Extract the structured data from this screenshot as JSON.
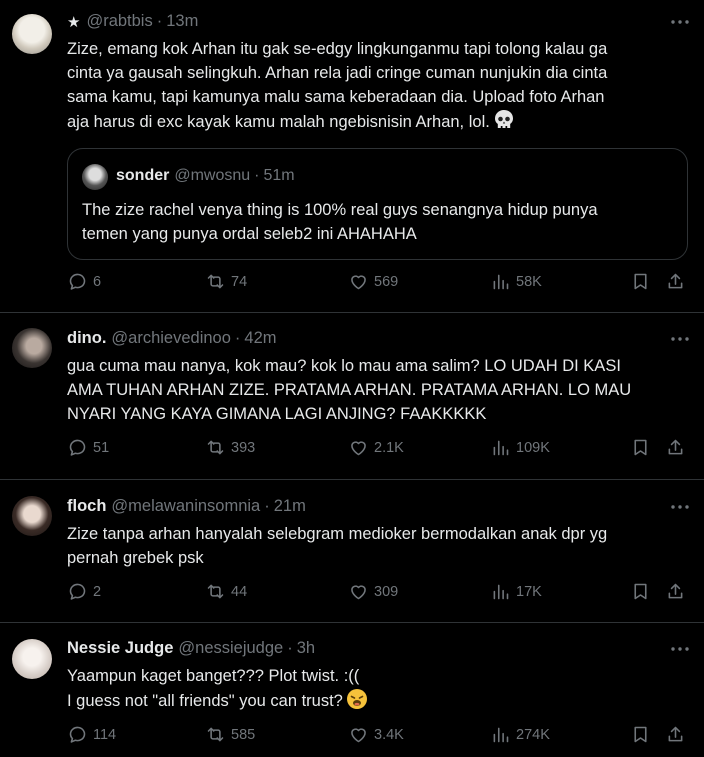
{
  "posts": [
    {
      "name": "",
      "star": "★",
      "handle": "@rabtbis",
      "time": "13m",
      "lines": [
        "Zize, emang kok Arhan itu gak se-edgy lingkunganmu tapi tolong kalau ga",
        "cinta ya gausah selingkuh. Arhan rela jadi cringe cuman nunjukin dia cinta",
        "sama kamu, tapi kamunya malu sama keberadaan dia. Upload foto Arhan",
        "aja harus di exc kayak kamu malah ngebisnisin Arhan, lol."
      ],
      "emoji": "skull",
      "quote": {
        "name": "sonder",
        "handle": "@mwosnu",
        "time": "51m",
        "lines": [
          "The zize rachel venya thing is 100% real guys senangnya hidup punya",
          "temen yang punya ordal seleb2 ini AHAHAHA"
        ]
      },
      "replies": "6",
      "reposts": "74",
      "likes": "569",
      "views": "58K"
    },
    {
      "name": "dino.",
      "handle": "@archievedinoo",
      "time": "42m",
      "lines": [
        "gua cuma mau nanya, kok mau? kok lo mau ama salim? LO UDAH DI KASI",
        "AMA TUHAN ARHAN ZIZE. PRATAMA ARHAN. PRATAMA ARHAN. LO MAU",
        "NYARI YANG KAYA GIMANA LAGI ANJING? FAAKKKKK"
      ],
      "replies": "51",
      "reposts": "393",
      "likes": "2.1K",
      "views": "109K"
    },
    {
      "name": "floch",
      "handle": "@melawaninsomnia",
      "time": "21m",
      "lines": [
        "Zize tanpa arhan hanyalah selebgram medioker bermodalkan anak dpr yg",
        "pernah grebek psk"
      ],
      "replies": "2",
      "reposts": "44",
      "likes": "309",
      "views": "17K"
    },
    {
      "name": "Nessie Judge",
      "handle": "@nessiejudge",
      "time": "3h",
      "lines": [
        "Yaampun kaget banget??? Plot twist. :((",
        "I guess not \"all friends\" you can trust?"
      ],
      "emoji": "weary-face",
      "replies": "114",
      "reposts": "585",
      "likes": "3.4K",
      "views": "274K"
    }
  ],
  "separator": "·"
}
